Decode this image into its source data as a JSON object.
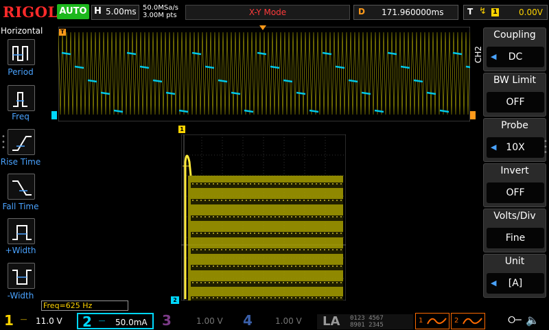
{
  "topbar": {
    "logo": "RIGOL",
    "run_state": "AUTO",
    "horizontal_key": "H",
    "timebase": "5.00ms",
    "sample_rate": "50.0MSa/s",
    "memory_depth": "3.00M pts",
    "mode": "X-Y Mode",
    "delay_key": "D",
    "delay": "171.960000ms",
    "trigger_key": "T",
    "trigger_source": "1",
    "trigger_level": "0.00V"
  },
  "left_menu": {
    "title": "Horizontal",
    "items": [
      {
        "label": "Period",
        "icon": "period-icon"
      },
      {
        "label": "Freq",
        "icon": "freq-icon"
      },
      {
        "label": "Rise Time",
        "icon": "rise-time-icon"
      },
      {
        "label": "Fall Time",
        "icon": "fall-time-icon"
      },
      {
        "label": "+Width",
        "icon": "plus-width-icon"
      },
      {
        "label": "-Width",
        "icon": "minus-width-icon"
      }
    ]
  },
  "right_menu": {
    "channel_tag": "CH2",
    "items": [
      {
        "title": "Coupling",
        "value": "DC"
      },
      {
        "title": "BW Limit",
        "value": "OFF"
      },
      {
        "title": "Probe",
        "value": "10X"
      },
      {
        "title": "Invert",
        "value": "OFF"
      },
      {
        "title": "Volts/Div",
        "value": "Fine"
      },
      {
        "title": "Unit",
        "value": "[A]"
      }
    ]
  },
  "measurement": "Freq=625 Hz",
  "markers": {
    "trigger": "T",
    "ch1": "1",
    "ch2": "2"
  },
  "channels": [
    {
      "num": "1",
      "scale": "11.0 V",
      "color": "#ffd400"
    },
    {
      "num": "2",
      "scale": "50.0mA",
      "color": "#00d8ff"
    },
    {
      "num": "3",
      "scale": "1.00 V",
      "color": "#b04ac0"
    },
    {
      "num": "4",
      "scale": "1.00 V",
      "color": "#3a6cd0"
    }
  ],
  "la": {
    "label": "LA",
    "row1": "0123 4567",
    "row2": "8901 2345"
  },
  "math": {
    "m1": "1",
    "m2": "2"
  },
  "colors": {
    "ch1": "#ffd400",
    "ch2": "#00d8ff",
    "menu_accent": "#4aa3ff",
    "run": "#1db81d",
    "mode_text": "#ff3b3b",
    "delay": "#ff9a1a",
    "math": "#ff6a00"
  }
}
